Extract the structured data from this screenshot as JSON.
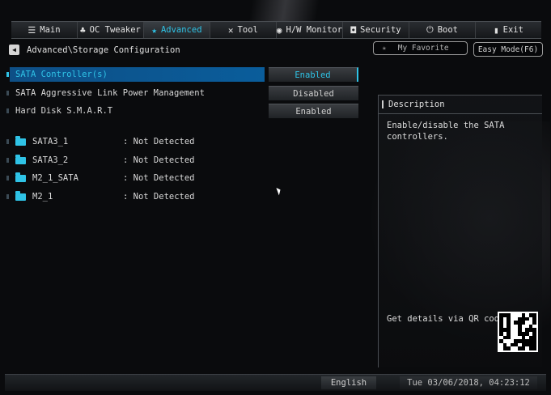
{
  "tabs": [
    {
      "label": "Main",
      "icon": "☰"
    },
    {
      "label": "OC Tweaker",
      "icon": "♣"
    },
    {
      "label": "Advanced",
      "icon": "★"
    },
    {
      "label": "Tool",
      "icon": "✕"
    },
    {
      "label": "H/W Monitor",
      "icon": "◉"
    },
    {
      "label": "Security",
      "icon": "◘"
    },
    {
      "label": "Boot",
      "icon": "⏻"
    },
    {
      "label": "Exit",
      "icon": "▮"
    }
  ],
  "breadcrumb": {
    "back_icon": "◀",
    "path": "Advanced\\Storage Configuration"
  },
  "favorite_button": {
    "star": "★",
    "label": "My Favorite"
  },
  "easy_mode_button": {
    "label": "Easy Mode(F6)"
  },
  "settings": [
    {
      "label": "SATA Controller(s)",
      "value": "Enabled"
    },
    {
      "label": "SATA Aggressive Link Power Management",
      "value": "Disabled"
    },
    {
      "label": "Hard Disk S.M.A.R.T",
      "value": "Enabled"
    }
  ],
  "drives": [
    {
      "name": "SATA3_1",
      "status": ": Not Detected"
    },
    {
      "name": "SATA3_2",
      "status": ": Not Detected"
    },
    {
      "name": "M2_1_SATA",
      "status": ": Not Detected"
    },
    {
      "name": "M2_1",
      "status": ": Not Detected"
    }
  ],
  "description": {
    "title": "Description",
    "text": "Enable/disable the SATA controllers.",
    "qr_label": "Get details via QR code"
  },
  "footer": {
    "language": "English",
    "datetime": "Tue 03/06/2018, 04:23:12"
  },
  "colors": {
    "accent": "#2fc3e6",
    "selected_bar": "#0a5d9b",
    "background": "#0a0b0d"
  }
}
